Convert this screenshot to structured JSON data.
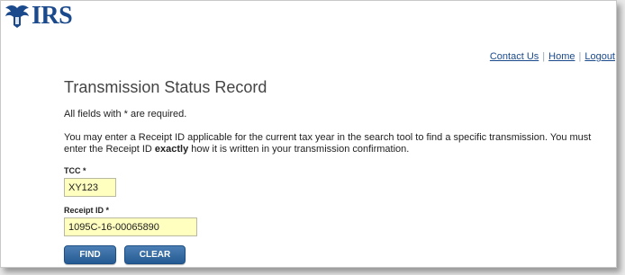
{
  "header": {
    "logo_text": "IRS",
    "links": [
      "Contact Us",
      "Home",
      "Logout"
    ]
  },
  "main": {
    "title": "Transmission Status Record",
    "required_note": "All fields with * are required.",
    "desc_before": "You may enter a Receipt ID applicable for the current tax year in the search tool to find a specific transmission. You must enter the Receipt ID ",
    "desc_bold": "exactly",
    "desc_after": " how it is written in your transmission confirmation.",
    "tcc": {
      "label": "TCC *",
      "value": "XY123"
    },
    "receipt_id": {
      "label": "Receipt ID *",
      "value": "1095C-16-00065890"
    },
    "buttons": {
      "find": "FIND",
      "clear": "CLEAR"
    }
  },
  "colors": {
    "brand_blue": "#1b4a8c",
    "button_blue": "#2f6aa5",
    "input_highlight": "#ffffc0"
  }
}
